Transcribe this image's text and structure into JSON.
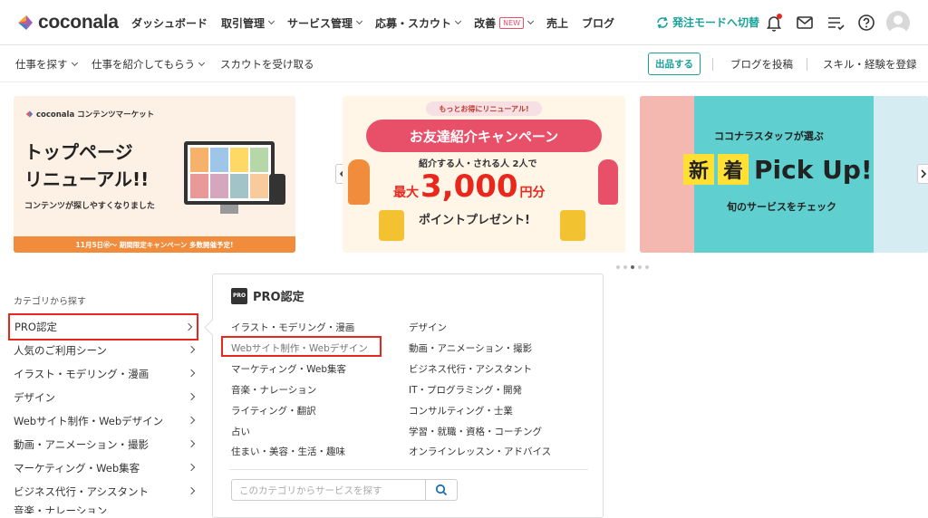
{
  "header": {
    "logo_text": "coconala",
    "nav": [
      {
        "label": "ダッシュボード",
        "dropdown": false
      },
      {
        "label": "取引管理",
        "dropdown": true
      },
      {
        "label": "サービス管理",
        "dropdown": true
      },
      {
        "label": "応募・スカウト",
        "dropdown": true
      },
      {
        "label": "改善",
        "badge": "NEW",
        "dropdown": true
      },
      {
        "label": "売上",
        "dropdown": false
      },
      {
        "label": "ブログ",
        "dropdown": false
      }
    ],
    "mode_switch": "発注モードへ切替",
    "icons": [
      "bell-icon",
      "mail-icon",
      "list-icon",
      "help-icon",
      "avatar"
    ],
    "accent_color": "#1aa29a"
  },
  "subnav": {
    "left": [
      {
        "label": "仕事を探す",
        "dropdown": true
      },
      {
        "label": "仕事を紹介してもらう",
        "dropdown": true
      },
      {
        "label": "スカウトを受け取る",
        "dropdown": false
      }
    ],
    "post_button": "出品する",
    "right": [
      "ブログを投稿",
      "スキル・経験を登録"
    ]
  },
  "banners": {
    "b1": {
      "brand": "coconala コンテンツマーケット",
      "title1": "トップページ",
      "title2": "リニューアル!!",
      "sub": "コンテンツが探しやすくなりました",
      "footer": "11月5日㊌〜 期間限定キャンペーン 多数開催予定!"
    },
    "b2": {
      "ribbon": "もっとお得にリニューアル!",
      "title": "お友達紹介キャンペーン",
      "sub": "紹介する人・される人 2人で",
      "prefix": "最大",
      "amount": "3,000",
      "unit": "円分",
      "footer": "ポイントプレゼント!"
    },
    "b3": {
      "top": "ココナラスタッフが選ぶ",
      "k1": "新",
      "k2": "着",
      "pick": "Pick Up!",
      "footer": "旬のサービスをチェック"
    }
  },
  "categories": {
    "heading": "カテゴリから探す",
    "items": [
      "PRO認定",
      "人気のご利用シーン",
      "イラスト・モデリング・漫画",
      "デザイン",
      "Webサイト制作・Webデザイン",
      "動画・アニメーション・撮影",
      "マーケティング・Web集客",
      "ビジネス代行・アシスタント",
      "音楽・ナレーション"
    ]
  },
  "panel": {
    "badge": "PRO",
    "title": "PRO認定",
    "left": [
      "イラスト・モデリング・漫画",
      "Webサイト制作・Webデザイン",
      "マーケティング・Web集客",
      "音楽・ナレーション",
      "ライティング・翻訳",
      "占い",
      "住まい・美容・生活・趣味"
    ],
    "right": [
      "デザイン",
      "動画・アニメーション・撮影",
      "ビジネス代行・アシスタント",
      "IT・プログラミング・開発",
      "コンサルティング・士業",
      "学習・就職・資格・コーチング",
      "オンラインレッスン・アドバイス"
    ],
    "search_placeholder": "このカテゴリからサービスを探す"
  },
  "highlight_color": "#e8271d"
}
